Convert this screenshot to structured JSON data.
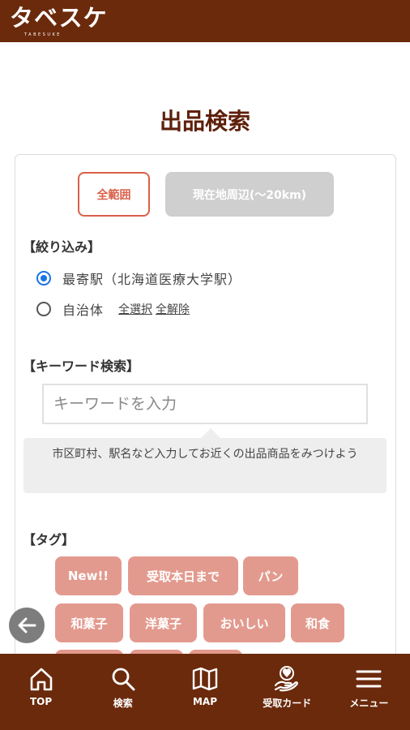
{
  "header": {
    "logo_text": "タベスケ",
    "logo_subtext": "TABESUKE"
  },
  "page": {
    "title": "出品検索"
  },
  "range": {
    "all_label": "全範囲",
    "near_label": "現在地周辺(〜20km)"
  },
  "filter": {
    "section_label": "【絞り込み】",
    "option_station": "最寄駅（北海道医療大学駅）",
    "option_municipality": "自治体",
    "select_all": "全選択",
    "deselect_all": "全解除",
    "selected": "station"
  },
  "keyword": {
    "section_label": "【キーワード検索】",
    "placeholder": "キーワードを入力",
    "value": "",
    "hint": "市区町村、駅名など入力してお近くの出品商品をみつけよう"
  },
  "tags": {
    "section_label": "【タグ】",
    "items": [
      "New!!",
      "受取本日まで",
      "パン",
      "和菓子",
      "洋菓子",
      "おいしい",
      "和食"
    ]
  },
  "bottom_nav": {
    "items": [
      {
        "label": "TOP",
        "icon": "home-icon"
      },
      {
        "label": "検索",
        "icon": "search-icon"
      },
      {
        "label": "MAP",
        "icon": "map-icon"
      },
      {
        "label": "受取カード",
        "icon": "receive-card-icon"
      },
      {
        "label": "メニュー",
        "icon": "menu-icon"
      }
    ]
  },
  "colors": {
    "brand_brown": "#6b2a0c",
    "title_brown": "#5e1f0a",
    "accent_red": "#d9604a",
    "tag_pink": "#e39a8e",
    "radio_blue": "#1a73e8"
  }
}
